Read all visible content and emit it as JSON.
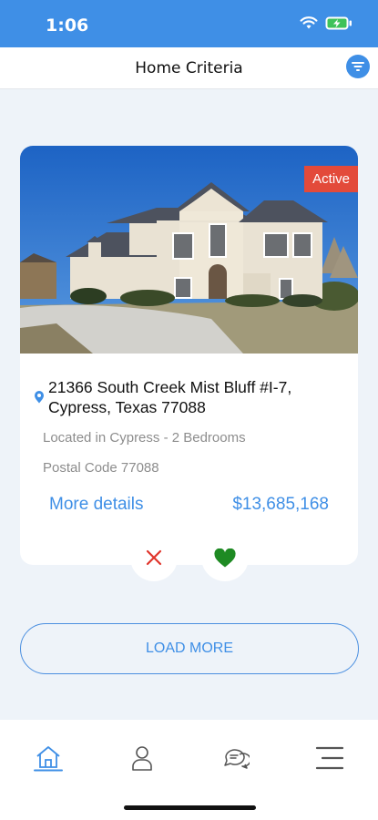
{
  "status_bar": {
    "time": "1:06"
  },
  "header": {
    "title": "Home Criteria"
  },
  "listing": {
    "status": "Active",
    "address_line1": "21366 South Creek Mist Bluff #I-7,",
    "address_line2": "Cypress, Texas 77088",
    "location_beds": "Located in Cypress - 2 Bedrooms",
    "postal_code": "Postal Code 77088",
    "details_label": "More details",
    "price": "$13,685,168"
  },
  "load_more_label": "LOAD MORE",
  "colors": {
    "accent": "#3f8fe6",
    "badge": "#e34a3a",
    "reject": "#e0352b",
    "like": "#1e8a23"
  },
  "tabs": [
    {
      "icon": "home-icon",
      "active": true
    },
    {
      "icon": "person-icon",
      "active": false
    },
    {
      "icon": "chat-icon",
      "active": false
    },
    {
      "icon": "menu-icon",
      "active": false
    }
  ]
}
